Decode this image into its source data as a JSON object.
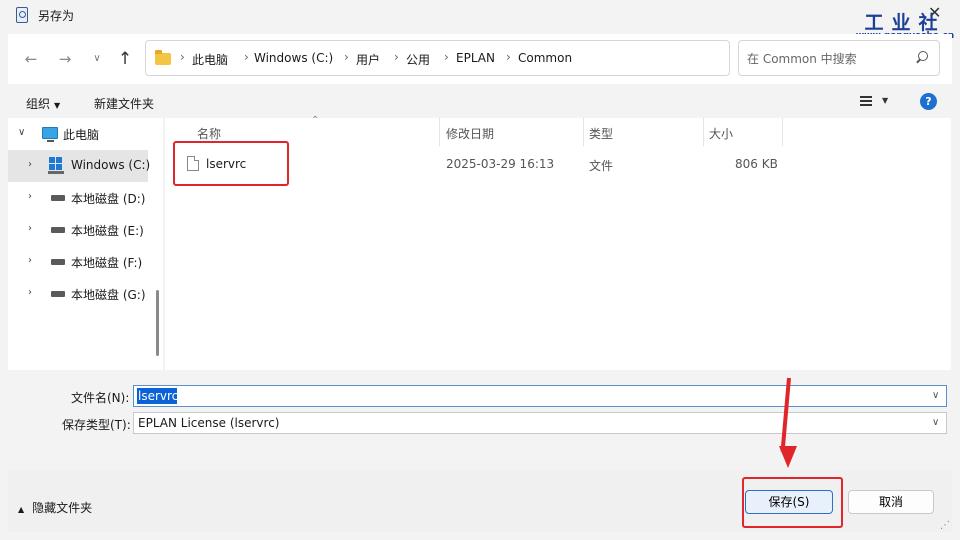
{
  "window": {
    "title": "另存为"
  },
  "logo": {
    "main": "工业社",
    "sub": "www.gongyeshe.cn"
  },
  "nav": {
    "breadcrumb": [
      "此电脑",
      "Windows (C:)",
      "用户",
      "公用",
      "EPLAN",
      "Common"
    ],
    "search_placeholder": "在 Common 中搜索"
  },
  "toolbar": {
    "organize_label": "组织",
    "new_folder_label": "新建文件夹"
  },
  "sidebar": {
    "items": [
      {
        "label": "此电脑",
        "expanded": true
      },
      {
        "label": "Windows (C:)",
        "selected": true
      },
      {
        "label": "本地磁盘 (D:)"
      },
      {
        "label": "本地磁盘 (E:)"
      },
      {
        "label": "本地磁盘 (F:)"
      },
      {
        "label": "本地磁盘 (G:)"
      }
    ]
  },
  "files": {
    "columns": {
      "name": "名称",
      "date": "修改日期",
      "type": "类型",
      "size": "大小"
    },
    "rows": [
      {
        "name": "lservrc",
        "date": "2025-03-29 16:13",
        "type": "文件",
        "size": "806 KB"
      }
    ]
  },
  "form": {
    "filename_label": "文件名(N):",
    "filename_value": "lservrc",
    "filetype_label": "保存类型(T):",
    "filetype_value": "EPLAN License (lservrc)"
  },
  "footer": {
    "hide_folders_label": "隐藏文件夹",
    "save_label": "保存(S)",
    "cancel_label": "取消"
  },
  "colors": {
    "accent": "#0a62d6",
    "annotation_red": "#e0262a",
    "save_border": "#2b6fcc"
  },
  "icons": [
    "folder-icon",
    "search-icon",
    "refresh-icon",
    "pc-icon",
    "windows-drive-icon",
    "drive-icon",
    "file-icon",
    "help-icon",
    "view-list-icon"
  ]
}
